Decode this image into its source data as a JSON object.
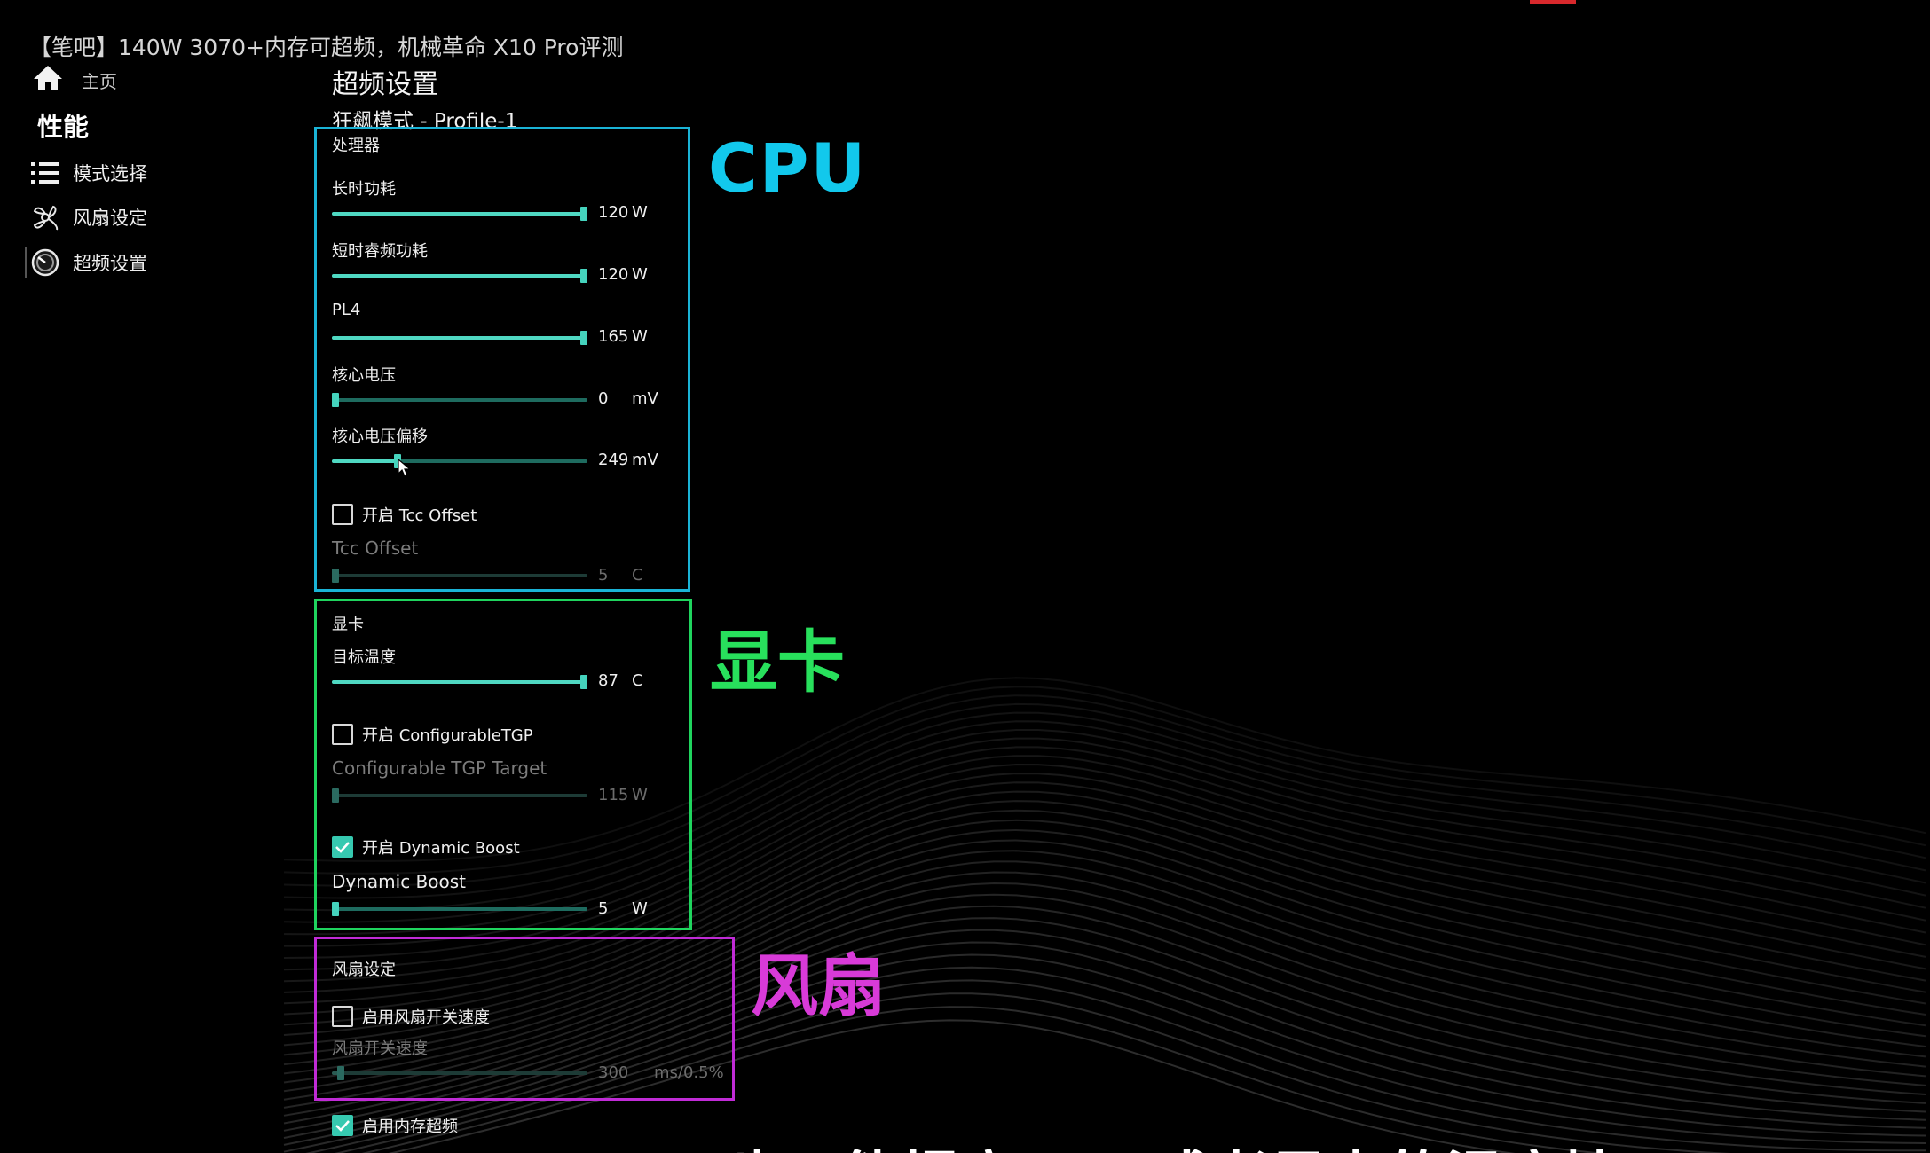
{
  "video_title": "【笔吧】140W 3070+内存可超频，机械革命 X10 Pro评测",
  "sidebar": {
    "home": "主页",
    "section": "性能",
    "items": [
      {
        "label": "模式选择",
        "icon": "list-icon"
      },
      {
        "label": "风扇设定",
        "icon": "fan-icon"
      },
      {
        "label": "超频设置",
        "icon": "gauge-icon",
        "active": true
      }
    ]
  },
  "page": {
    "title": "超频设置",
    "profile": "狂飙模式 - Profile-1"
  },
  "annotations": {
    "cpu": "CPU",
    "gpu": "显卡",
    "fan": "风扇"
  },
  "colors": {
    "accent": "#45d3bd",
    "cpu_box": "#1ab3d6",
    "gpu_box": "#1fd45e",
    "fan_box": "#c02bd6"
  },
  "cpu": {
    "title": "处理器",
    "sliders": [
      {
        "label": "长时功耗",
        "value": "120",
        "unit": "W",
        "fill": 1.0
      },
      {
        "label": "短时睿频功耗",
        "value": "120",
        "unit": "W",
        "fill": 1.0
      },
      {
        "label": "PL4",
        "value": "165",
        "unit": "W",
        "fill": 1.0
      },
      {
        "label": "核心电压",
        "value": "0",
        "unit": "mV",
        "fill": 0.0
      },
      {
        "label": "核心电压偏移",
        "value": "249",
        "unit": "mV",
        "fill": 0.25
      }
    ],
    "tcc_checkbox": {
      "label": "开启 Tcc Offset",
      "checked": false
    },
    "tcc_slider": {
      "label": "Tcc Offset",
      "value": "5",
      "unit": "C",
      "fill": 0.0
    }
  },
  "gpu": {
    "title": "显卡",
    "target_temp": {
      "label": "目标温度",
      "value": "87",
      "unit": "C",
      "fill": 1.0
    },
    "tgp_checkbox": {
      "label": "开启 ConfigurableTGP",
      "checked": false
    },
    "tgp_slider": {
      "label": "Configurable TGP Target",
      "value": "115",
      "unit": "W",
      "fill": 0.0
    },
    "boost_checkbox": {
      "label": "开启 Dynamic Boost",
      "checked": true
    },
    "boost_slider": {
      "label": "Dynamic Boost",
      "value": "5",
      "unit": "W",
      "fill": 0.0
    }
  },
  "fan": {
    "title": "风扇设定",
    "checkbox": {
      "label": "启用风扇开关速度",
      "checked": false
    },
    "slider": {
      "label": "风扇开关速度",
      "value": "300",
      "unit": "ms/0.5%",
      "fill": 0.02
    }
  },
  "memory_oc": {
    "label": "启用内存超频",
    "checked": true
  },
  "subtitle": "也可能提高CPU或者显卡的温度墙"
}
